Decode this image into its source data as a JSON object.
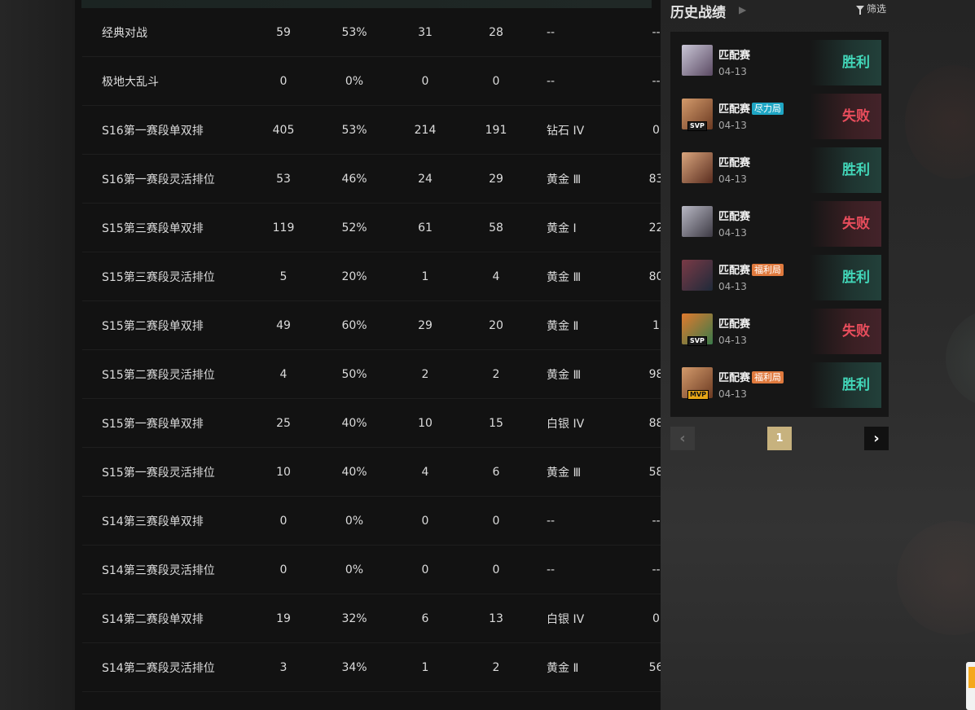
{
  "stats_table": {
    "rows": [
      [
        "经典对战",
        "59",
        "53%",
        "31",
        "28",
        "--",
        "--"
      ],
      [
        "极地大乱斗",
        "0",
        "0%",
        "0",
        "0",
        "--",
        "--"
      ],
      [
        "S16第一赛段单双排",
        "405",
        "53%",
        "214",
        "191",
        "钻石 IV",
        "0"
      ],
      [
        "S16第一赛段灵活排位",
        "53",
        "46%",
        "24",
        "29",
        "黄金 Ⅲ",
        "83"
      ],
      [
        "S15第三赛段单双排",
        "119",
        "52%",
        "61",
        "58",
        "黄金 Ⅰ",
        "22"
      ],
      [
        "S15第三赛段灵活排位",
        "5",
        "20%",
        "1",
        "4",
        "黄金 Ⅲ",
        "80"
      ],
      [
        "S15第二赛段单双排",
        "49",
        "60%",
        "29",
        "20",
        "黄金 Ⅱ",
        "1"
      ],
      [
        "S15第二赛段灵活排位",
        "4",
        "50%",
        "2",
        "2",
        "黄金 Ⅲ",
        "98"
      ],
      [
        "S15第一赛段单双排",
        "25",
        "40%",
        "10",
        "15",
        "白银 IV",
        "88"
      ],
      [
        "S15第一赛段灵活排位",
        "10",
        "40%",
        "4",
        "6",
        "黄金 Ⅲ",
        "58"
      ],
      [
        "S14第三赛段单双排",
        "0",
        "0%",
        "0",
        "0",
        "--",
        "--"
      ],
      [
        "S14第三赛段灵活排位",
        "0",
        "0%",
        "0",
        "0",
        "--",
        "--"
      ],
      [
        "S14第二赛段单双排",
        "19",
        "32%",
        "6",
        "13",
        "白银 IV",
        "0"
      ],
      [
        "S14第二赛段灵活排位",
        "3",
        "34%",
        "1",
        "2",
        "黄金 Ⅱ",
        "56"
      ]
    ]
  },
  "history": {
    "title": "历史战绩",
    "filter_label": "筛选",
    "items": [
      {
        "type": "匹配赛",
        "tag": "",
        "tag_color": "",
        "badge": "",
        "date": "04-13",
        "result": "胜利",
        "outcome": "win",
        "avatar_colors": [
          "#c9c6d6",
          "#5b4a63"
        ]
      },
      {
        "type": "匹配赛",
        "tag": "尽力局",
        "tag_color": "#1fa6c4",
        "badge": "SVP",
        "date": "04-13",
        "result": "失败",
        "outcome": "loss",
        "avatar_colors": [
          "#d39a6b",
          "#6b3a22"
        ]
      },
      {
        "type": "匹配赛",
        "tag": "",
        "tag_color": "",
        "badge": "",
        "date": "04-13",
        "result": "胜利",
        "outcome": "win",
        "avatar_colors": [
          "#d9a57d",
          "#5a2d1f"
        ]
      },
      {
        "type": "匹配赛",
        "tag": "",
        "tag_color": "",
        "badge": "",
        "date": "04-13",
        "result": "失败",
        "outcome": "loss",
        "avatar_colors": [
          "#b8b8c4",
          "#3d3a44"
        ]
      },
      {
        "type": "匹配赛",
        "tag": "福利局",
        "tag_color": "#e07a3e",
        "badge": "",
        "date": "04-13",
        "result": "胜利",
        "outcome": "win",
        "avatar_colors": [
          "#7a3a46",
          "#1f2a3a"
        ]
      },
      {
        "type": "匹配赛",
        "tag": "",
        "tag_color": "",
        "badge": "SVP",
        "date": "04-13",
        "result": "失败",
        "outcome": "loss",
        "avatar_colors": [
          "#e07a2e",
          "#3a7a4a"
        ]
      },
      {
        "type": "匹配赛",
        "tag": "福利局",
        "tag_color": "#e07a3e",
        "badge": "MVP",
        "date": "04-13",
        "result": "胜利",
        "outcome": "win",
        "avatar_colors": [
          "#d39a6b",
          "#6b3a22"
        ]
      }
    ]
  },
  "pagination": {
    "current_page": "1"
  },
  "colors": {
    "win": "#42d7b9",
    "loss": "#e84d5c",
    "page_active": "#c7b27e"
  }
}
